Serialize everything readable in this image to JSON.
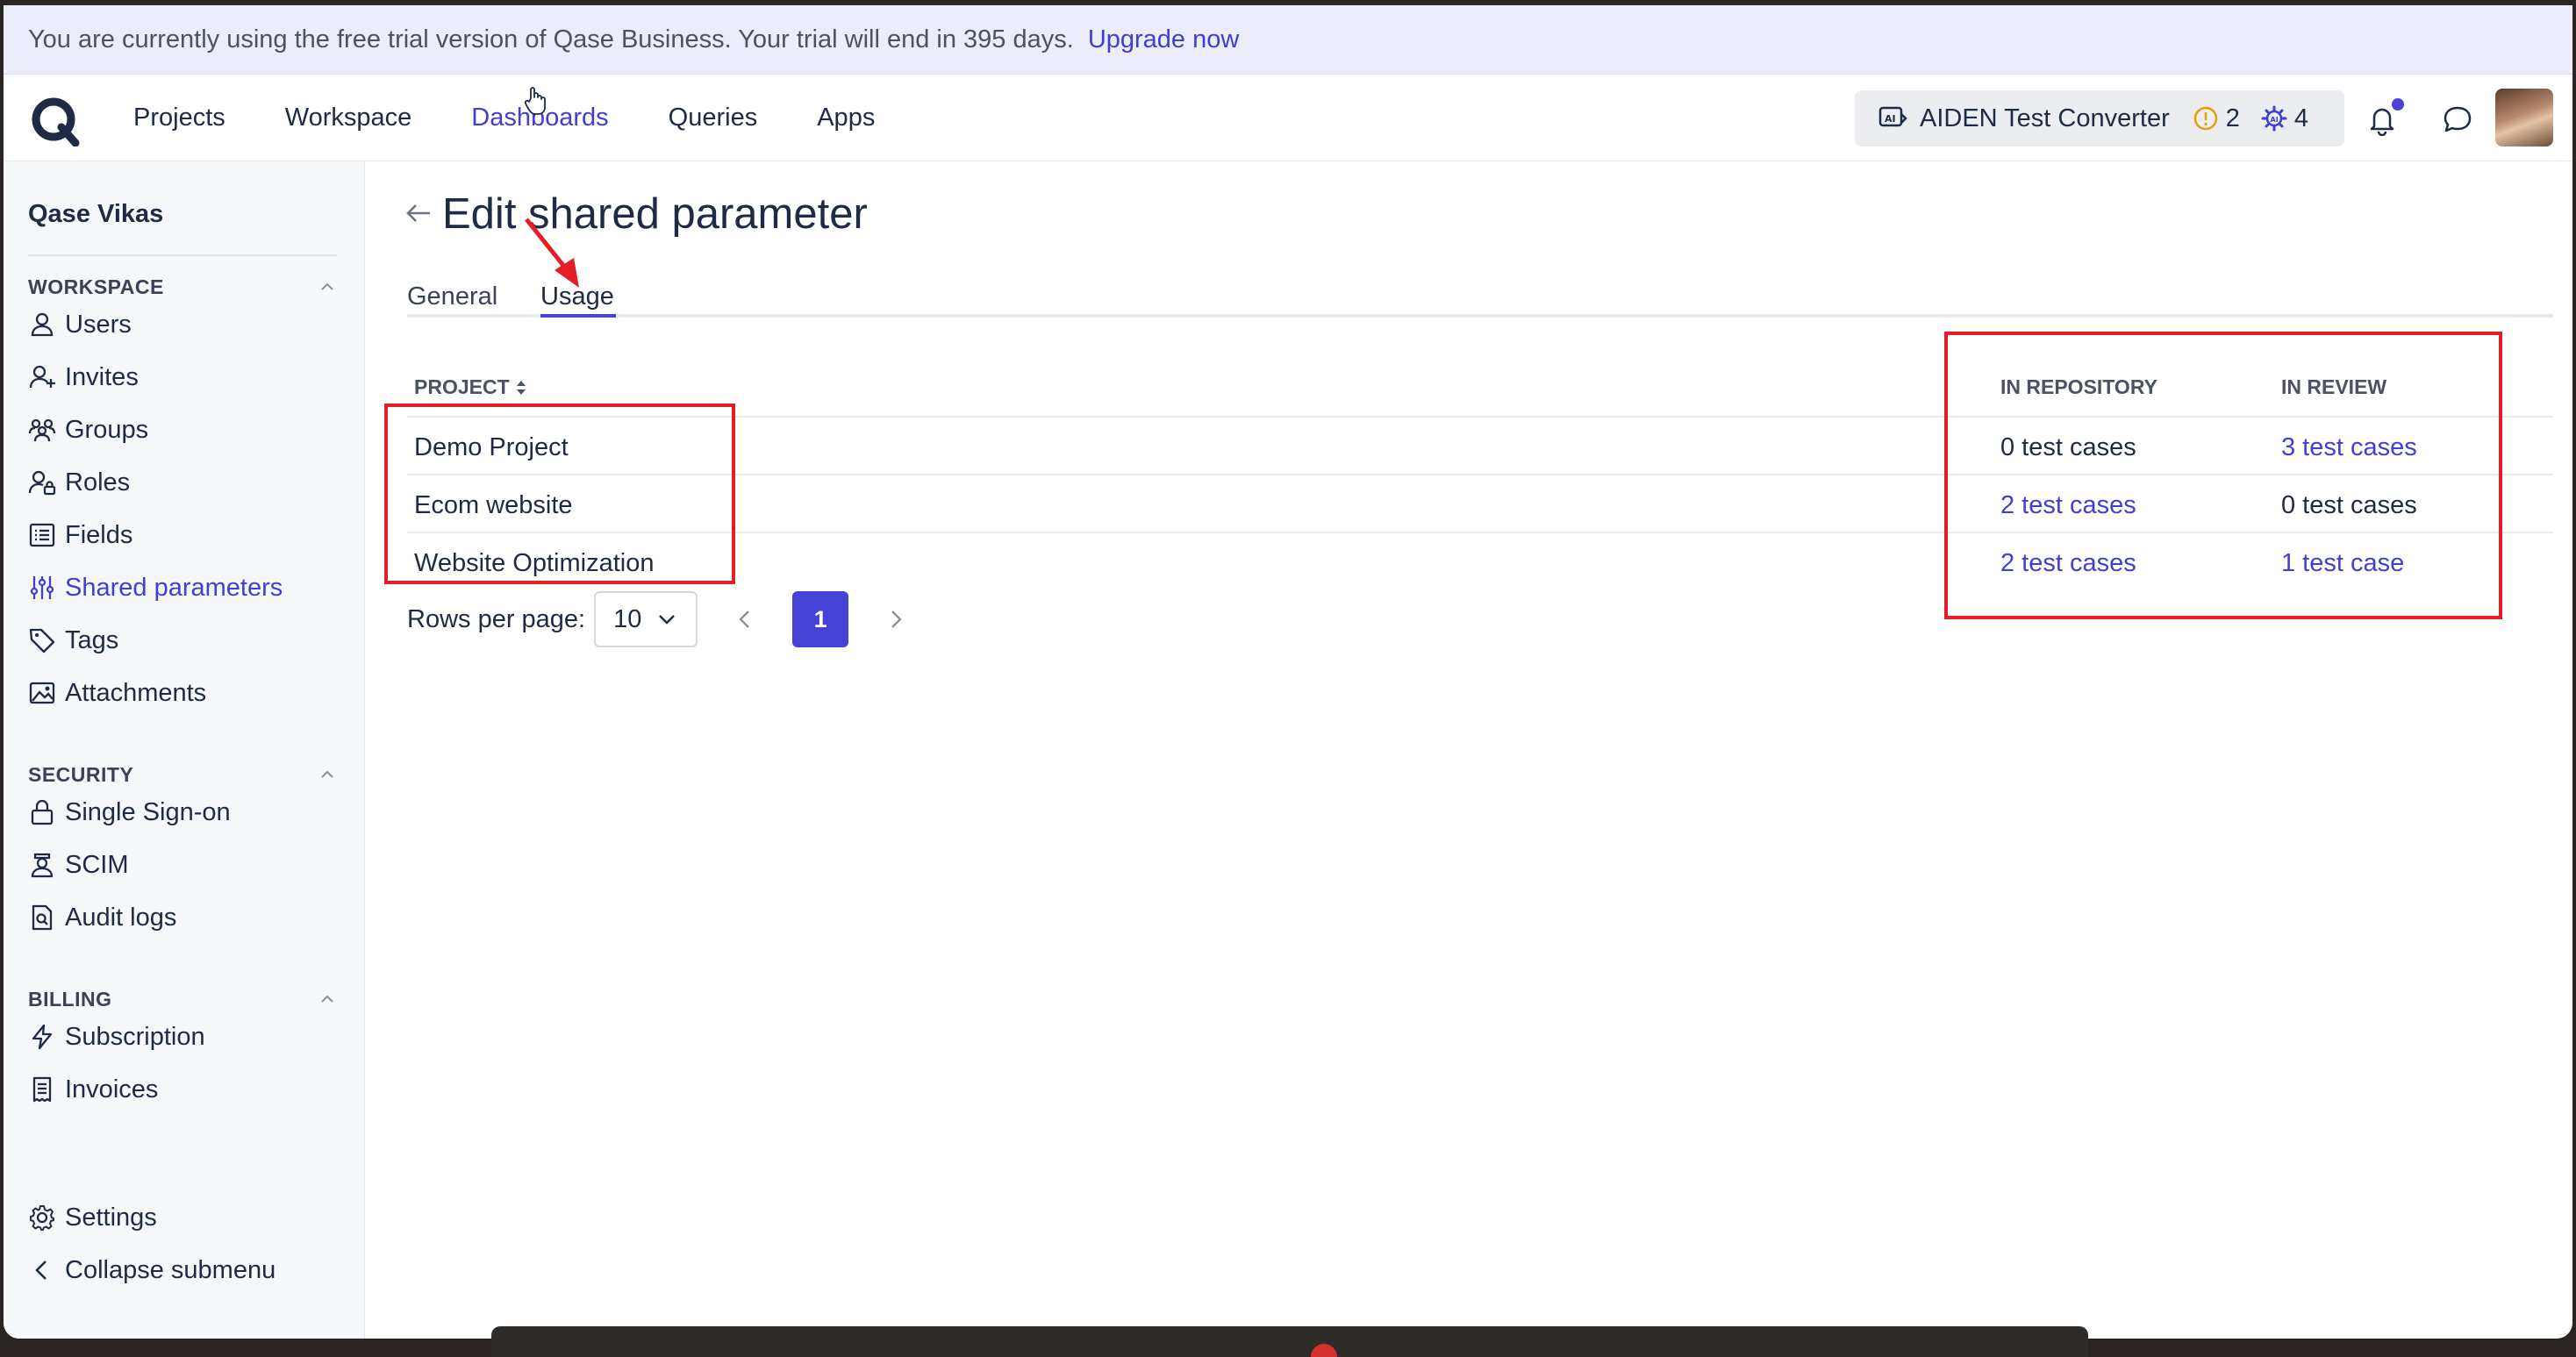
{
  "banner": {
    "message": "You are currently using the free trial version of Qase Business.  Your trial will end in 395 days.",
    "upgrade_link": "Upgrade now"
  },
  "topnav": {
    "items": [
      {
        "label": "Projects"
      },
      {
        "label": "Workspace"
      },
      {
        "label": "Dashboards"
      },
      {
        "label": "Queries"
      },
      {
        "label": "Apps"
      }
    ],
    "active_item": "Dashboards",
    "project_chip": {
      "name": "AIDEN Test Converter",
      "warning_count": "2",
      "ai_count": "4"
    }
  },
  "sidebar": {
    "workspace_name": "Qase Vikas",
    "sections": [
      {
        "title": "WORKSPACE",
        "items": [
          {
            "label": "Users",
            "icon": "user-icon"
          },
          {
            "label": "Invites",
            "icon": "user-plus-icon"
          },
          {
            "label": "Groups",
            "icon": "users-icon"
          },
          {
            "label": "Roles",
            "icon": "user-lock-icon"
          },
          {
            "label": "Fields",
            "icon": "list-icon"
          },
          {
            "label": "Shared parameters",
            "icon": "sliders-icon"
          },
          {
            "label": "Tags",
            "icon": "tag-icon"
          },
          {
            "label": "Attachments",
            "icon": "image-icon"
          }
        ]
      },
      {
        "title": "SECURITY",
        "items": [
          {
            "label": "Single Sign-on",
            "icon": "lock-icon"
          },
          {
            "label": "SCIM",
            "icon": "user-shield-icon"
          },
          {
            "label": "Audit logs",
            "icon": "file-search-icon"
          }
        ]
      },
      {
        "title": "BILLING",
        "items": [
          {
            "label": "Subscription",
            "icon": "bolt-icon"
          },
          {
            "label": "Invoices",
            "icon": "receipt-icon"
          }
        ]
      }
    ],
    "active_item": "Shared parameters",
    "footer": {
      "settings": "Settings",
      "collapse": "Collapse submenu"
    }
  },
  "main": {
    "title": "Edit shared parameter",
    "tabs": [
      {
        "label": "General"
      },
      {
        "label": "Usage"
      }
    ],
    "active_tab": "Usage",
    "table": {
      "columns": [
        "PROJECT",
        "IN REPOSITORY",
        "IN REVIEW"
      ],
      "rows": [
        {
          "project": "Demo Project",
          "in_repository": "0 test cases",
          "in_review": "3 test cases"
        },
        {
          "project": "Ecom website",
          "in_repository": "2 test cases",
          "in_review": "0 test cases"
        },
        {
          "project": "Website Optimization",
          "in_repository": "2 test cases",
          "in_review": "1 test case"
        }
      ]
    },
    "pagination": {
      "rows_per_page_label": "Rows per page:",
      "rows_per_page_value": "10",
      "current_page": "1"
    }
  },
  "colors": {
    "accent": "#3f3fd3",
    "annotation": "#e41e26",
    "banner_bg": "#ecedfb"
  }
}
